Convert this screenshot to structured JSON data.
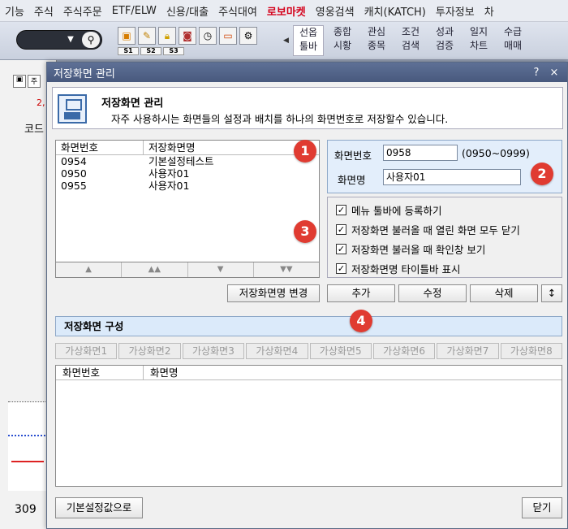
{
  "menu": {
    "items": [
      "기능",
      "주식",
      "주식주문",
      "ETF/ELW",
      "신용/대출",
      "주식대여",
      "로보마켓",
      "영웅검색",
      "캐치(KATCH)",
      "투자정보",
      "차"
    ],
    "highlight_index": 6
  },
  "toolbar": {
    "slots": [
      "S1",
      "S2",
      "S3"
    ],
    "nav_buttons": [
      {
        "line1": "선옵",
        "line2": "툴바"
      },
      {
        "line1": "종합",
        "line2": "시황"
      },
      {
        "line1": "관심",
        "line2": "종목"
      },
      {
        "line1": "조건",
        "line2": "검색"
      },
      {
        "line1": "성과",
        "line2": "검증"
      },
      {
        "line1": "일지",
        "line2": "차트"
      },
      {
        "line1": "수급",
        "line2": "매매"
      }
    ]
  },
  "background": {
    "tab1": "주",
    "red_value": "2,",
    "code_label": "코드",
    "bottom_number": "309"
  },
  "dialog": {
    "title": "저장화면 관리",
    "help_btn": "?",
    "close_btn": "×",
    "header_title": "저장화면 관리",
    "header_desc": "자주 사용하시는 화면들의 설정과 배치를 하나의 화면번호로 저장할수 있습니다.",
    "list": {
      "col1": "화면번호",
      "col2": "저장화면명",
      "rows": [
        {
          "num": "0954",
          "name": "기본설정테스트"
        },
        {
          "num": "0950",
          "name": "사용자01"
        },
        {
          "num": "0955",
          "name": "사용자01"
        }
      ],
      "nav": [
        "▲",
        "▲▲",
        "▼",
        "▼▼"
      ]
    },
    "rename_btn": "저장화면명 변경",
    "screen_num_label": "화면번호",
    "screen_num_value": "0958",
    "screen_num_range": "(0950~0999)",
    "screen_name_label": "화면명",
    "screen_name_value": "사용자01",
    "checks": [
      {
        "label": "메뉴 툴바에 등록하기",
        "checked": true
      },
      {
        "label": "저장화면 불러올 때 열린 화면 모두 닫기",
        "checked": true
      },
      {
        "label": "저장화면 불러올 때 확인창 보기",
        "checked": true
      },
      {
        "label": "저장화면명 타이틀바 표시",
        "checked": true
      }
    ],
    "add_btn": "추가",
    "edit_btn": "수정",
    "delete_btn": "삭제",
    "sort_btn": "↕",
    "section_title": "저장화면 구성",
    "virtual_tabs": [
      "가상화면1",
      "가상화면2",
      "가상화면3",
      "가상화면4",
      "가상화면5",
      "가상화면6",
      "가상화면7",
      "가상화면8"
    ],
    "grid_col1": "화면번호",
    "grid_col2": "화면명",
    "default_btn": "기본설정값으로",
    "close_text_btn": "닫기"
  },
  "markers": [
    "1",
    "2",
    "3",
    "4"
  ],
  "colors": {
    "marker": "#e03b31",
    "title_bar": "#4e5f84",
    "menu_highlight": "#d4001a"
  }
}
